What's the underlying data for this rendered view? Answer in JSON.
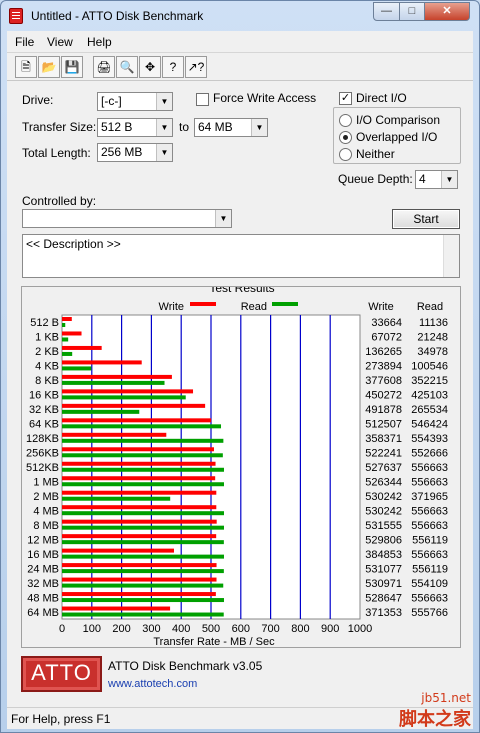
{
  "window": {
    "title": "Untitled - ATTO Disk Benchmark"
  },
  "menu": {
    "items": [
      "File",
      "View",
      "Help"
    ]
  },
  "toolbar": {
    "icons": [
      "new-icon",
      "open-icon",
      "save-icon",
      "print-icon",
      "print-preview-icon",
      "move-icon",
      "help-icon",
      "context-help-icon"
    ]
  },
  "settings": {
    "drive_label": "Drive:",
    "drive_value": "[-c-]",
    "force_write_label": "Force Write Access",
    "direct_io_label": "Direct I/O",
    "transfer_size_label": "Transfer Size:",
    "transfer_from": "512 B",
    "to_label": "to",
    "transfer_to": "64 MB",
    "total_length_label": "Total Length:",
    "total_length_value": "256 MB",
    "io_comparison_label": "I/O Comparison",
    "overlapped_io_label": "Overlapped I/O",
    "neither_label": "Neither",
    "queue_depth_label": "Queue Depth:",
    "queue_depth_value": "4",
    "controlled_by_label": "Controlled by:",
    "start_label": "Start",
    "description_text": "<< Description >>"
  },
  "results": {
    "group_title": "Test Results",
    "write_label": "Write",
    "read_label": "Read",
    "write_col": "Write",
    "read_col": "Read",
    "write_color": "#ff0000",
    "read_color": "#00a000",
    "grid_color": "#0000cc"
  },
  "chart_data": {
    "type": "bar",
    "xlabel": "Transfer Rate - MB / Sec",
    "xlim": [
      0,
      1000
    ],
    "xticks": [
      "0",
      "100",
      "200",
      "300",
      "400",
      "500",
      "600",
      "700",
      "800",
      "900",
      "1000"
    ],
    "categories": [
      "512 B",
      "1 KB",
      "2 KB",
      "4 KB",
      "8 KB",
      "16 KB",
      "32 KB",
      "64 KB",
      "128KB",
      "256KB",
      "512KB",
      "1 MB",
      "2 MB",
      "4 MB",
      "8 MB",
      "12 MB",
      "16 MB",
      "24 MB",
      "32 MB",
      "48 MB",
      "64 MB"
    ],
    "series": [
      {
        "name": "Write",
        "values": [
          32.9,
          65.5,
          133.1,
          267.5,
          368.8,
          439.7,
          480.3,
          500.5,
          350.0,
          510.0,
          515.2,
          514.0,
          517.8,
          517.8,
          519.1,
          517.4,
          375.8,
          518.6,
          518.5,
          516.3,
          362.7
        ]
      },
      {
        "name": "Read",
        "values": [
          10.9,
          20.7,
          34.2,
          98.2,
          344.0,
          415.2,
          259.3,
          533.6,
          541.5,
          539.7,
          543.6,
          543.6,
          363.1,
          543.6,
          543.6,
          543.1,
          543.6,
          543.1,
          541.1,
          543.6,
          542.7
        ]
      }
    ],
    "write_text": [
      "33664",
      "67072",
      "136265",
      "273894",
      "377608",
      "450272",
      "491878",
      "512507",
      "358371",
      "522241",
      "527637",
      "526344",
      "530242",
      "530242",
      "531555",
      "529806",
      "384853",
      "531077",
      "530971",
      "528647",
      "371353"
    ],
    "read_text": [
      "11136",
      "21248",
      "34978",
      "100546",
      "352215",
      "425103",
      "265534",
      "546424",
      "554393",
      "552666",
      "556663",
      "556663",
      "371965",
      "556663",
      "556663",
      "556119",
      "556663",
      "556119",
      "554109",
      "556663",
      "555766"
    ]
  },
  "footer": {
    "logo_text": "ATTO",
    "product": "ATTO Disk Benchmark v3.05",
    "url": "www.attotech.com"
  },
  "status": {
    "text": "For Help, press F1"
  },
  "watermark": {
    "site": "jb51.net",
    "name": "脚本之家"
  }
}
